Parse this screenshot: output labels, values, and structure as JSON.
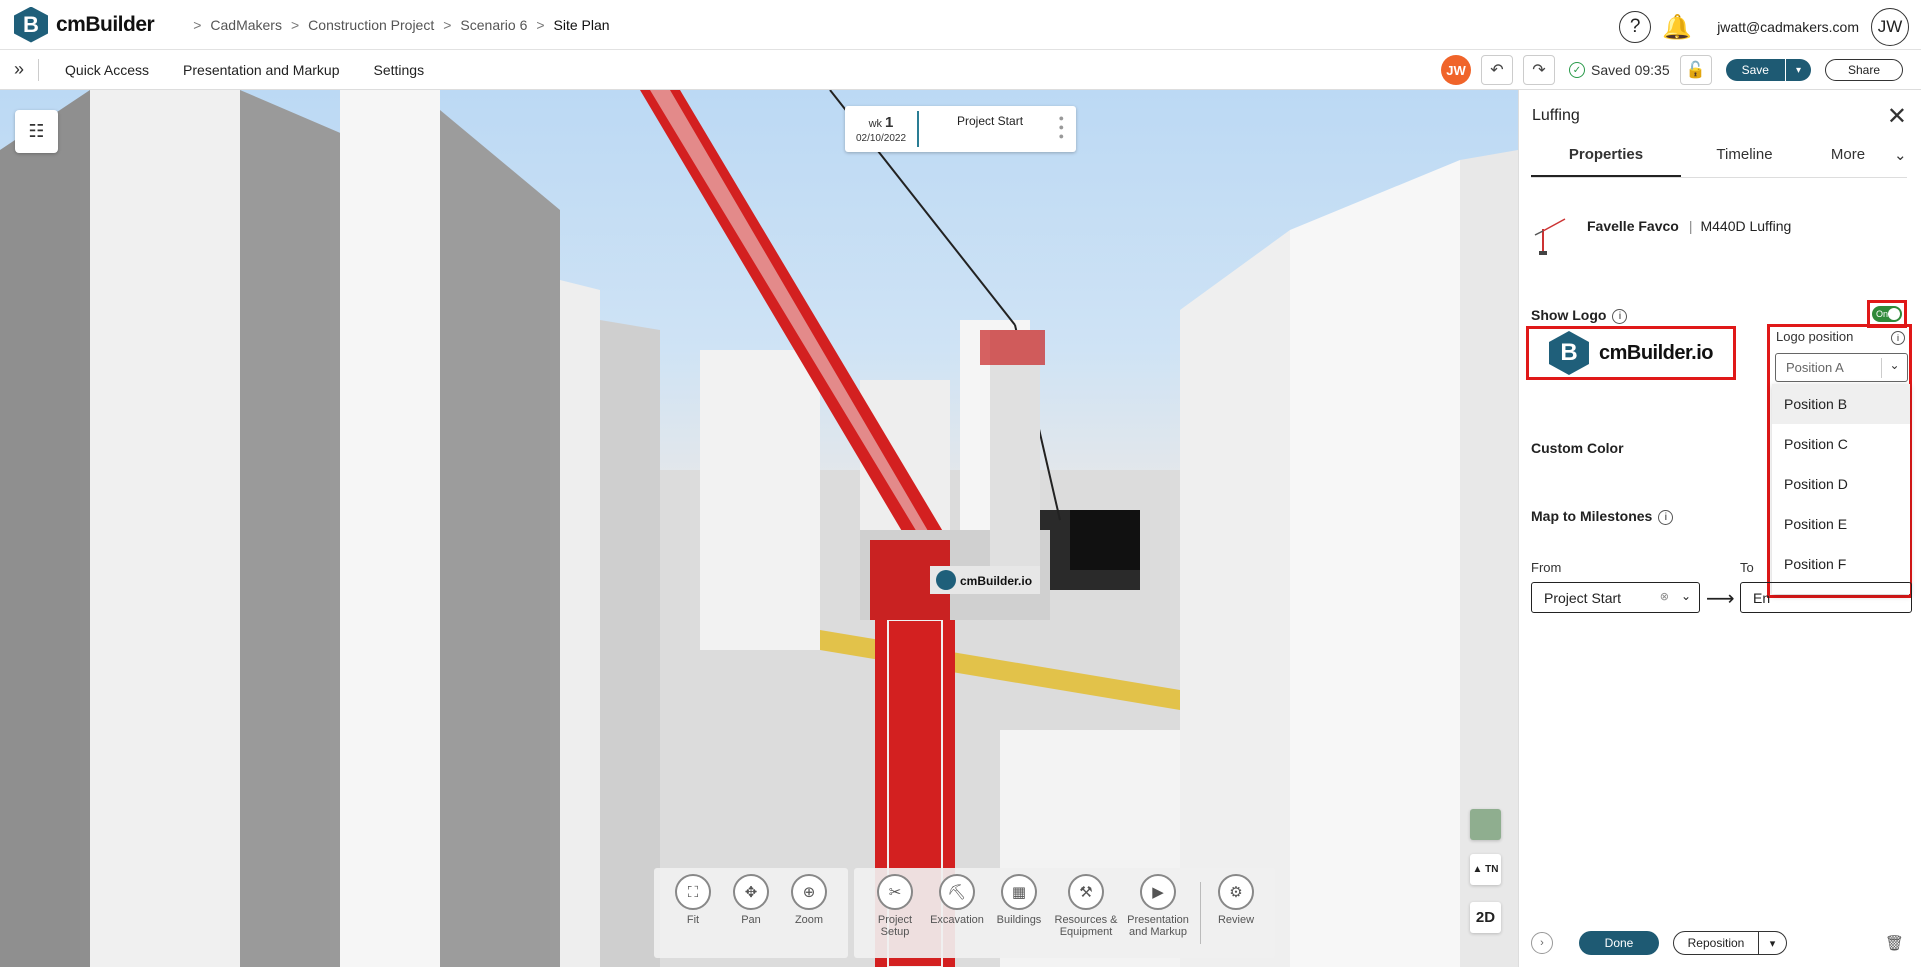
{
  "app": {
    "name": "cmBuilder",
    "logo_letter": "B"
  },
  "breadcrumb": [
    "CadMakers",
    "Construction Project",
    "Scenario 6",
    "Site Plan"
  ],
  "breadcrumb_sep": ">",
  "header": {
    "help": "?",
    "bell": "🔔",
    "email": "jwatt@cadmakers.com",
    "avatar": "JW"
  },
  "toolbar": {
    "expand": "»",
    "menu": [
      "Quick Access",
      "Presentation and Markup",
      "Settings"
    ],
    "avatar": "JW",
    "undo": "↶",
    "redo": "↷",
    "saved_check": "✓",
    "saved": "Saved 09:35",
    "lock": "🔓",
    "save": "Save",
    "save_dd": "▾",
    "share": "Share"
  },
  "viewport": {
    "tree_icon": "☷",
    "week": {
      "prefix": "wk",
      "number": "1",
      "date": "02/10/2022",
      "title": "Project Start",
      "dots": "●\n●\n●"
    },
    "crane_logo_text": "cmBuilder.io",
    "compass": "▲ TN",
    "view2d": "2D",
    "nav_view": [
      {
        "icon": "⛶",
        "label": "Fit"
      },
      {
        "icon": "✥",
        "label": "Pan"
      },
      {
        "icon": "⊕",
        "label": "Zoom"
      }
    ],
    "nav_tools": [
      {
        "icon": "✂",
        "label": "Project Setup"
      },
      {
        "icon": "⛏",
        "label": "Excavation"
      },
      {
        "icon": "▦",
        "label": "Buildings"
      },
      {
        "icon": "⚒",
        "label": "Resources & Equipment"
      },
      {
        "icon": "▶",
        "label": "Presentation and Markup"
      }
    ],
    "nav_review": {
      "icon": "⚙",
      "label": "Review"
    }
  },
  "panel": {
    "title": "Luffing",
    "close": "✕",
    "tabs": [
      "Properties",
      "Timeline",
      "More"
    ],
    "more_chev": "⌄",
    "crane": {
      "brand": "Favelle Favco",
      "sep": "|",
      "model": "M440D Luffing"
    },
    "show_logo": {
      "label": "Show Logo",
      "toggle": "On"
    },
    "logo_preview": {
      "letter": "B",
      "text": "cmBuilder.io"
    },
    "logo_position": {
      "label": "Logo position",
      "selected": "Position A",
      "options": [
        "Position B",
        "Position C",
        "Position D",
        "Position E",
        "Position F"
      ]
    },
    "custom_color": "Custom Color",
    "milestones": {
      "label": "Map to Milestones",
      "from_label": "From",
      "from_value": "Project Start",
      "to_label": "To",
      "to_value": "En"
    },
    "info": "i",
    "footer": {
      "prev": "›",
      "done": "Done",
      "reposition": "Reposition",
      "repo_dd": "▾",
      "trash": "🗑"
    }
  },
  "colors": {
    "brand": "#1e5a73",
    "accent_red": "#e01818",
    "toggle_green": "#2f8a3a",
    "avatar_orange": "#f0642a"
  }
}
